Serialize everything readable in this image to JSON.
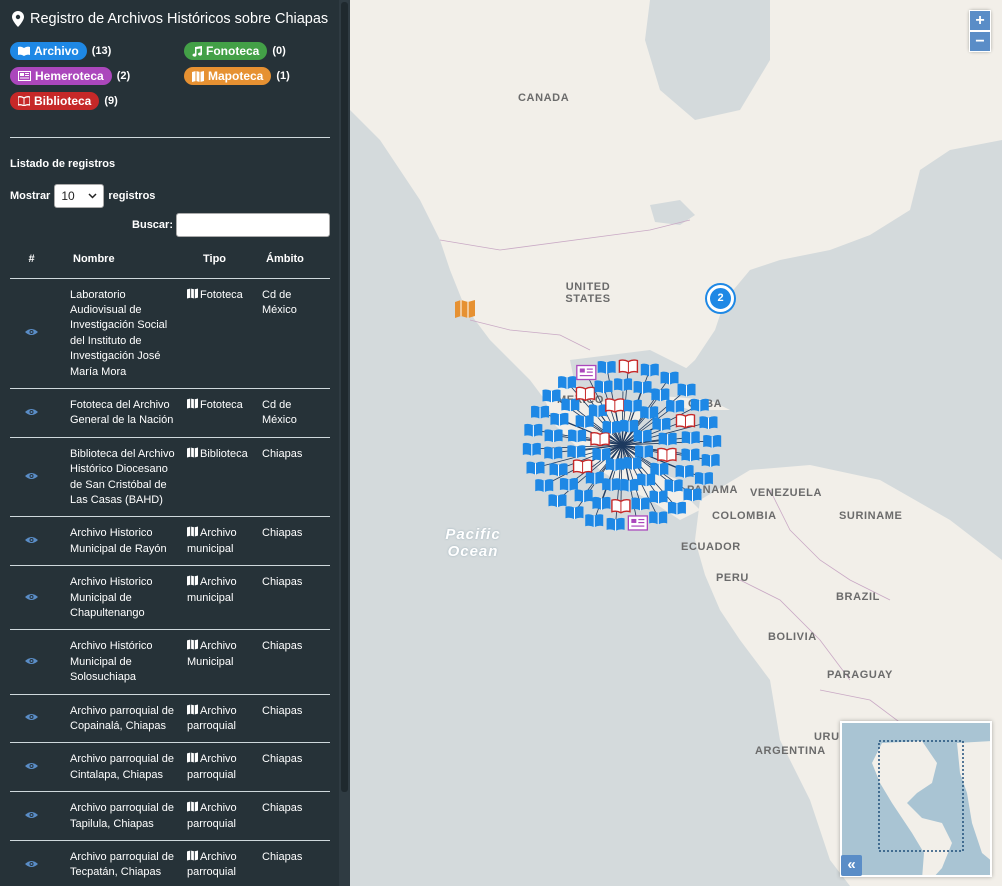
{
  "sidebar": {
    "title": "Registro de Archivos Históricos sobre Chiapas",
    "categories": [
      {
        "label": "Archivo",
        "count": "(13)",
        "color": "#1e88e5",
        "icon": "book-open-icon"
      },
      {
        "label": "Fonoteca",
        "count": "(0)",
        "color": "#43a047",
        "icon": "music-note-icon"
      },
      {
        "label": "Hemeroteca",
        "count": "(2)",
        "color": "#ab47bc",
        "icon": "newspaper-icon"
      },
      {
        "label": "Mapoteca",
        "count": "(1)",
        "color": "#e69132",
        "icon": "map-icon"
      },
      {
        "label": "Biblioteca",
        "count": "(9)",
        "color": "#c62828",
        "icon": "book-icon"
      }
    ],
    "list_title": "Listado de registros",
    "show_label": "Mostrar",
    "show_value": "10",
    "show_suffix": "registros",
    "search_label": "Buscar:",
    "search_value": "",
    "columns": [
      "#",
      "Nombre",
      "Tipo",
      "Ámbito"
    ],
    "rows": [
      {
        "nombre": "Laboratorio Audiovisual de Investigación Social del Instituto de Investigación José María Mora",
        "tipo": "Fototeca",
        "ambito": "Cd de México"
      },
      {
        "nombre": "Fototeca del Archivo General de la Nación",
        "tipo": "Fototeca",
        "ambito": "Cd de México"
      },
      {
        "nombre": "Biblioteca del Archivo Histórico Diocesano de San Cristóbal de Las Casas (BAHD)",
        "tipo": "Biblioteca",
        "ambito": "Chiapas"
      },
      {
        "nombre": "Archivo Historico Municipal de Rayón",
        "tipo": "Archivo municipal",
        "ambito": "Chiapas"
      },
      {
        "nombre": "Archivo Historico Municipal de Chapultenango",
        "tipo": "Archivo municipal",
        "ambito": "Chiapas"
      },
      {
        "nombre": "Archivo Histórico Municipal de Solosuchiapa",
        "tipo": "Archivo Municipal",
        "ambito": "Chiapas"
      },
      {
        "nombre": "Archivo parroquial de Copainalá, Chiapas",
        "tipo": "Archivo parroquial",
        "ambito": "Chiapas"
      },
      {
        "nombre": "Archivo parroquial de Cintalapa, Chiapas",
        "tipo": "Archivo parroquial",
        "ambito": "Chiapas"
      },
      {
        "nombre": "Archivo parroquial de Tapilula, Chiapas",
        "tipo": "Archivo parroquial",
        "ambito": "Chiapas"
      },
      {
        "nombre": "Archivo parroquial de Tecpatán, Chiapas",
        "tipo": "Archivo parroquial",
        "ambito": "Chiapas"
      }
    ]
  },
  "map": {
    "labels": {
      "canada": "CANADA",
      "us": "UNITED STATES",
      "mexico": "MEXICO",
      "cuba": "CUBA",
      "panama": "PANAMA",
      "venezuela": "VENEZUELA",
      "colombia": "COLOMBIA",
      "suriname": "SURINAME",
      "ecuador": "ECUADOR",
      "peru": "PERU",
      "brazil": "BRAZIL",
      "bolivia": "BOLIVIA",
      "paraguay": "PARAGUAY",
      "argentina": "ARGENTINA",
      "uruguay": "URU",
      "pacific": "Pacific Ocean"
    },
    "cluster_count": "2",
    "zoom_in": "+",
    "zoom_out": "−",
    "minimap_toggle": "«"
  }
}
